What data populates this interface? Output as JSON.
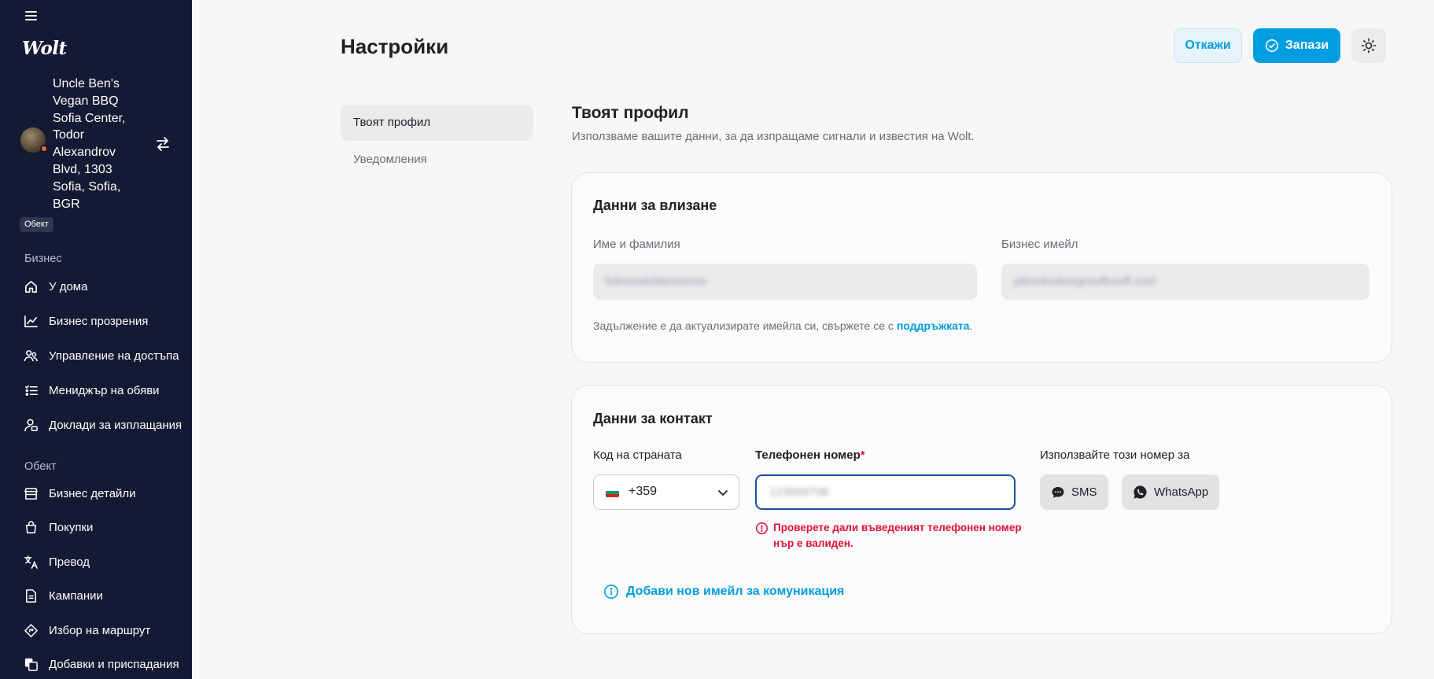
{
  "sidebar": {
    "brand": "Wolt",
    "venue": {
      "name": "Uncle Ben's Vegan BBQ Sofia Center, Todor Alexandrov Blvd, 1303 Sofia, Sofia, BGR",
      "badge": "Обект"
    },
    "business_section": "Бизнес",
    "business_items": [
      {
        "label": "У дома",
        "icon": "home-icon"
      },
      {
        "label": "Бизнес прозрения",
        "icon": "chart-line-icon"
      },
      {
        "label": "Управление на достъпа",
        "icon": "users-icon"
      },
      {
        "label": "Мениджър на обяви",
        "icon": "list-icon"
      },
      {
        "label": "Доклади за изплащания",
        "icon": "person-money-icon"
      }
    ],
    "venue_section": "Обект",
    "venue_items": [
      {
        "label": "Бизнес детайли",
        "icon": "store-icon"
      },
      {
        "label": "Покупки",
        "icon": "bag-icon"
      },
      {
        "label": "Превод",
        "icon": "translate-icon"
      },
      {
        "label": "Кампании",
        "icon": "document-icon"
      },
      {
        "label": "Избор на маршрут",
        "icon": "route-icon"
      },
      {
        "label": "Добавки и приспадания",
        "icon": "copy-icon"
      }
    ]
  },
  "header": {
    "title": "Настройки",
    "cancel_label": "Откажи",
    "save_label": "Запази"
  },
  "subnav": [
    {
      "label": "Твоят профил",
      "active": true
    },
    {
      "label": "Уведомления",
      "active": false
    }
  ],
  "profile": {
    "title": "Твоят профил",
    "subtitle": "Използваме вашите данни, за да изпращаме сигнали и известия на Wolt.",
    "login": {
      "title": "Данни за влизане",
      "name_label": "Име и фамилия",
      "name_value": "lolmoodoblessence",
      "email_label": "Бизнес имейл",
      "email_value": "jabookudoegesoftruoft.com",
      "help_prefix": "Задължение е да актуализирате имейла си, свържете се с ",
      "help_link": "поддръжката",
      "help_suffix": "."
    },
    "contact": {
      "title": "Данни за контакт",
      "country_label": "Код на страната",
      "country_value": "+359",
      "phone_label": "Телефонен номер",
      "phone_required": "*",
      "phone_value": "123569708",
      "error": "Проверете дали въведеният телефонен номер нър е валиден.",
      "use_label": "Използвайте този номер за",
      "sms_label": "SMS",
      "whatsapp_label": "WhatsApp",
      "add_email": "Добави нов имейл за комуникация"
    }
  },
  "colors": {
    "accent": "#009de0",
    "sidebar": "#141a33",
    "error": "#e0103a"
  }
}
